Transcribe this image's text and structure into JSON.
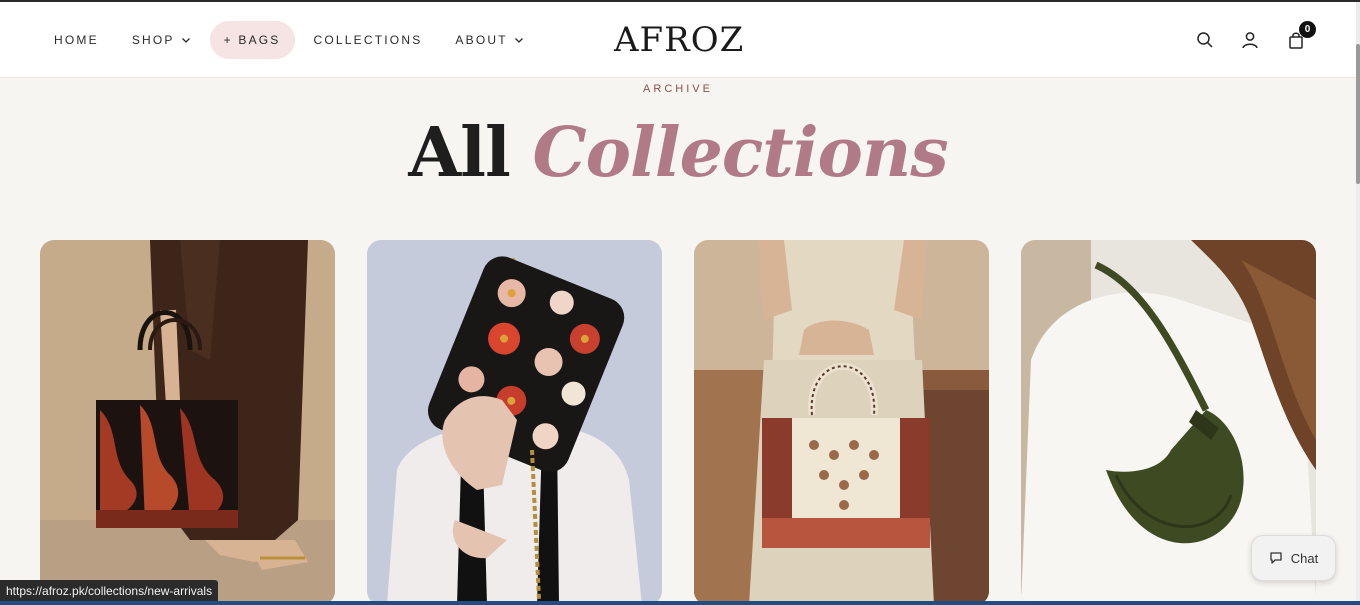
{
  "header": {
    "nav": [
      {
        "label": "HOME",
        "has_dropdown": false
      },
      {
        "label": "SHOP",
        "has_dropdown": true
      },
      {
        "label": "+ BAGS",
        "has_dropdown": false,
        "highlighted": true
      },
      {
        "label": "COLLECTIONS",
        "has_dropdown": false
      },
      {
        "label": "ABOUT",
        "has_dropdown": true
      }
    ],
    "logo": "AFROZ",
    "icons": [
      "search-icon",
      "account-icon",
      "cart-icon"
    ],
    "cart_count": "0"
  },
  "hero": {
    "eyebrow": "ARCHIVE",
    "title_plain": "All",
    "title_accent": "Collections",
    "accent_color": "#b07b86"
  },
  "collections": [
    {
      "image": "woman holding embroidered black and red paisley tote bag"
    },
    {
      "image": "woman holding black floral embroidered chain shoulder bag"
    },
    {
      "image": "woman holding beaded cream tote bag with floral border"
    },
    {
      "image": "woman wearing olive green leather crescent shoulder bag"
    }
  ],
  "status_bar": {
    "url": "https://afroz.pk/collections/new-arrivals"
  },
  "chat": {
    "label": "Chat"
  }
}
